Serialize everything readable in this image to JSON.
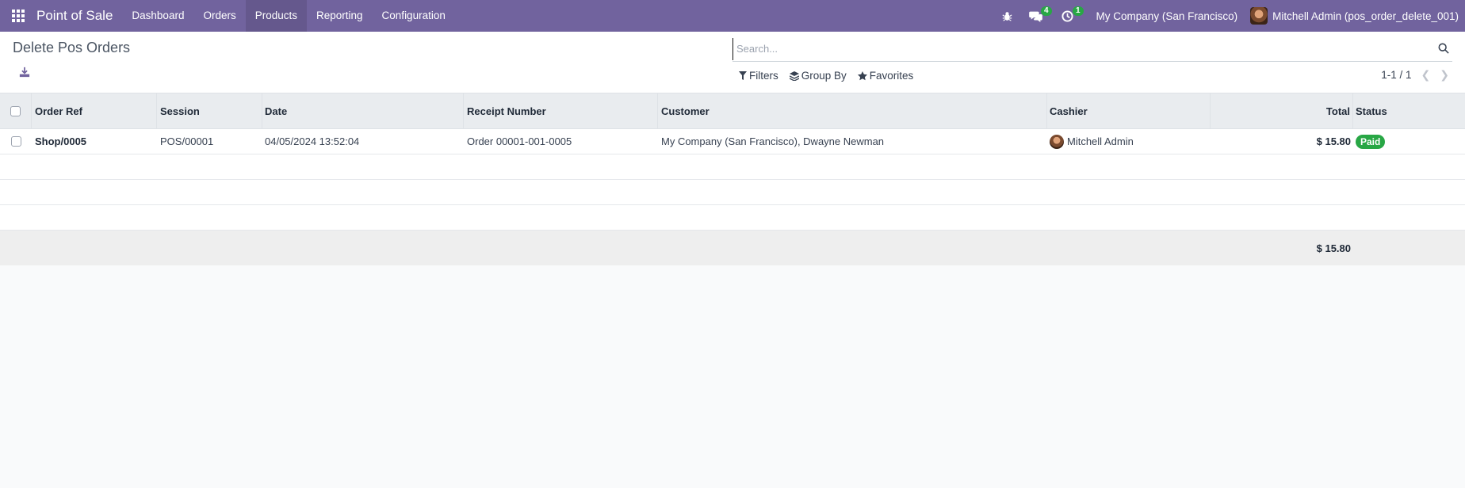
{
  "navbar": {
    "brand": "Point of Sale",
    "menu": [
      {
        "label": "Dashboard"
      },
      {
        "label": "Orders"
      },
      {
        "label": "Products"
      },
      {
        "label": "Reporting"
      },
      {
        "label": "Configuration"
      }
    ],
    "active_menu": "Products",
    "messages_count": "4",
    "activities_count": "1",
    "company": "My Company (San Francisco)",
    "user": "Mitchell Admin (pos_order_delete_001)"
  },
  "control": {
    "title": "Delete Pos Orders",
    "search_placeholder": "Search...",
    "filters_label": "Filters",
    "groupby_label": "Group By",
    "favorites_label": "Favorites",
    "pager": "1-1 / 1"
  },
  "table": {
    "headers": {
      "ref": "Order Ref",
      "session": "Session",
      "date": "Date",
      "receipt": "Receipt Number",
      "customer": "Customer",
      "cashier": "Cashier",
      "total": "Total",
      "status": "Status"
    },
    "rows": [
      {
        "ref": "Shop/0005",
        "session": "POS/00001",
        "date": "04/05/2024 13:52:04",
        "receipt": "Order 00001-001-0005",
        "customer": "My Company (San Francisco), Dwayne Newman",
        "cashier": "Mitchell Admin",
        "total": "$ 15.80",
        "status": "Paid"
      }
    ],
    "footer_total": "$ 15.80"
  },
  "colors": {
    "navbar": "#71639e",
    "status_paid": "#28a745"
  }
}
